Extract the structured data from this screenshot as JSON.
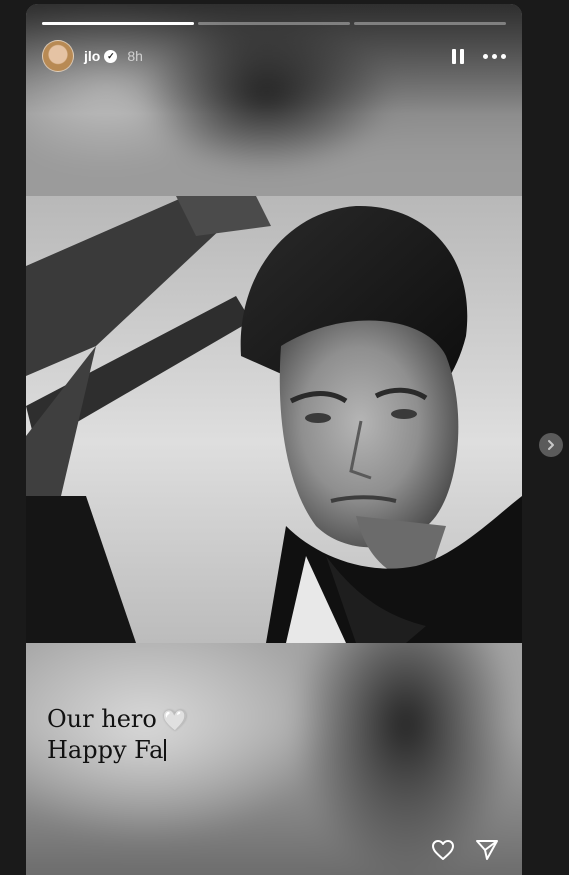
{
  "story": {
    "progress": [
      1,
      0,
      0
    ],
    "user": {
      "username": "jlo",
      "verified": true,
      "time_ago": "8h",
      "avatar": "avatar"
    },
    "controls": {
      "pause_icon": "pause-icon",
      "more_icon": "more-options-icon"
    },
    "caption": {
      "line1": "Our hero",
      "heart": "🤍",
      "line2": "Happy Fa"
    },
    "footer": {
      "like_icon": "heart-icon",
      "share_icon": "send-icon"
    },
    "navigation": {
      "next_icon": "chevron-right-icon"
    }
  }
}
